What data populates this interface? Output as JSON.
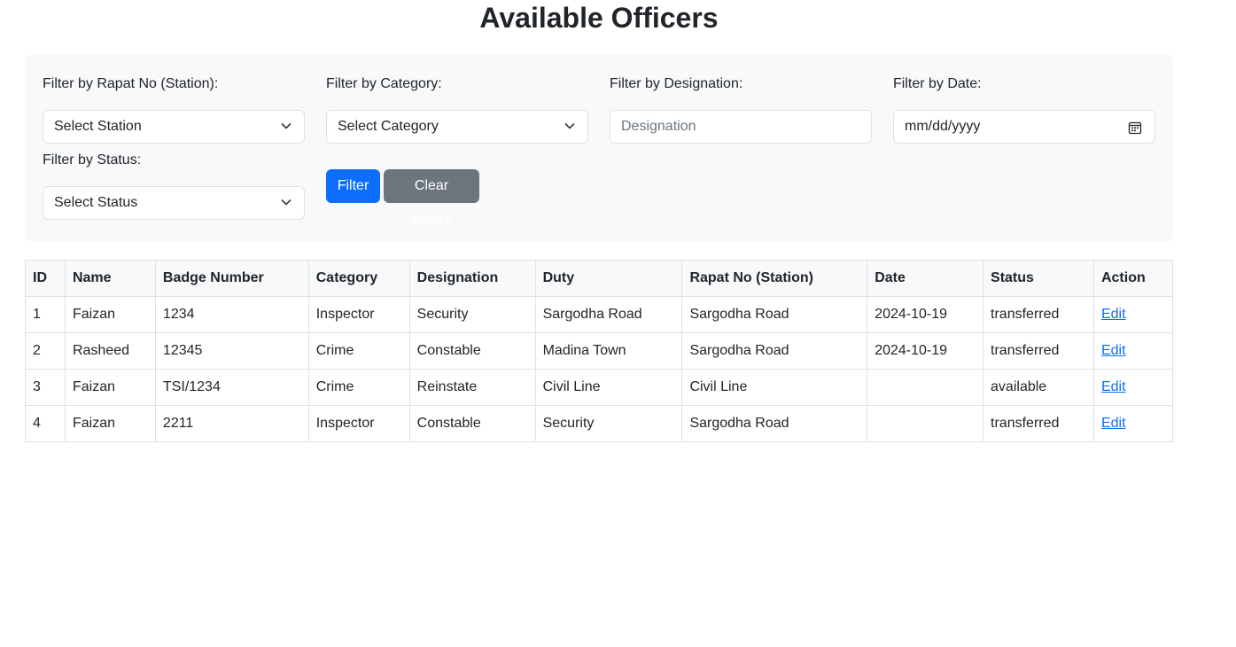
{
  "page": {
    "title": "Available Officers"
  },
  "filters": {
    "station": {
      "label": "Filter by Rapat No (Station):",
      "value": "Select Station"
    },
    "category": {
      "label": "Filter by Category:",
      "value": "Select Category"
    },
    "designation": {
      "label": "Filter by Designation:",
      "placeholder": "Designation"
    },
    "date": {
      "label": "Filter by Date:",
      "value": "mm/dd/yyyy"
    },
    "status": {
      "label": "Filter by Status:",
      "value": "Select Status"
    },
    "filter_button": "Filter",
    "clear_button": "Clear Filters"
  },
  "table": {
    "headers": [
      "ID",
      "Name",
      "Badge Number",
      "Category",
      "Designation",
      "Duty",
      "Rapat No (Station)",
      "Date",
      "Status",
      "Action"
    ],
    "rows": [
      {
        "id": "1",
        "name": "Faizan",
        "badge": "1234",
        "category": "Inspector",
        "designation": "Security",
        "duty": "Sargodha Road",
        "station": "Sargodha Road",
        "date": "2024-10-19",
        "status": "transferred",
        "action": "Edit"
      },
      {
        "id": "2",
        "name": "Rasheed",
        "badge": "12345",
        "category": "Crime",
        "designation": "Constable",
        "duty": "Madina Town",
        "station": "Sargodha Road",
        "date": "2024-10-19",
        "status": "transferred",
        "action": "Edit"
      },
      {
        "id": "3",
        "name": "Faizan",
        "badge": "TSI/1234",
        "category": "Crime",
        "designation": "Reinstate",
        "duty": "Civil Line",
        "station": "Civil Line",
        "date": "",
        "status": "available",
        "action": "Edit"
      },
      {
        "id": "4",
        "name": "Faizan",
        "badge": "2211",
        "category": "Inspector",
        "designation": "Constable",
        "duty": "Security",
        "station": "Sargodha Road",
        "date": "",
        "status": "transferred",
        "action": "Edit"
      }
    ]
  }
}
